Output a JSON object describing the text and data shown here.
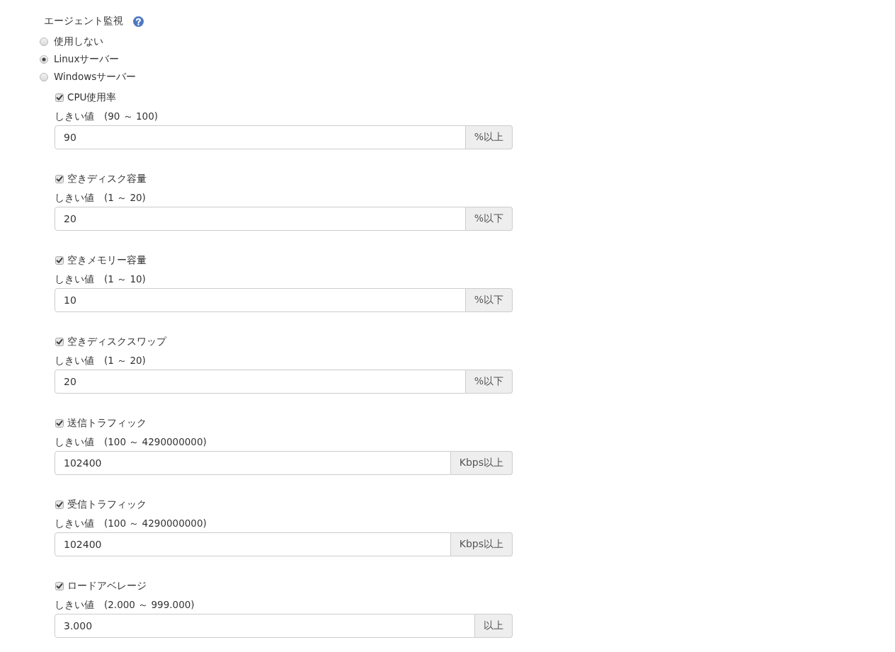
{
  "section": {
    "title": "エージェント監視"
  },
  "modes": [
    {
      "label": "使用しない",
      "selected": false
    },
    {
      "label": "Linuxサーバー",
      "selected": true
    },
    {
      "label": "Windowsサーバー",
      "selected": false
    }
  ],
  "metrics": [
    {
      "label": "CPU使用率",
      "checked": true,
      "threshold_label": "しきい値　(90 ～ 100)",
      "value": "90",
      "unit": "%以上"
    },
    {
      "label": "空きディスク容量",
      "checked": true,
      "threshold_label": "しきい値　(1 ～ 20)",
      "value": "20",
      "unit": "%以下"
    },
    {
      "label": "空きメモリー容量",
      "checked": true,
      "threshold_label": "しきい値　(1 ～ 10)",
      "value": "10",
      "unit": "%以下"
    },
    {
      "label": "空きディスクスワップ",
      "checked": true,
      "threshold_label": "しきい値　(1 ～ 20)",
      "value": "20",
      "unit": "%以下"
    },
    {
      "label": "送信トラフィック",
      "checked": true,
      "threshold_label": "しきい値　(100 ～ 4290000000)",
      "value": "102400",
      "unit": "Kbps以上"
    },
    {
      "label": "受信トラフィック",
      "checked": true,
      "threshold_label": "しきい値　(100 ～ 4290000000)",
      "value": "102400",
      "unit": "Kbps以上"
    },
    {
      "label": "ロードアベレージ",
      "checked": true,
      "threshold_label": "しきい値　(2.000 ～ 999.000)",
      "value": "3.000",
      "unit": "以上"
    }
  ]
}
